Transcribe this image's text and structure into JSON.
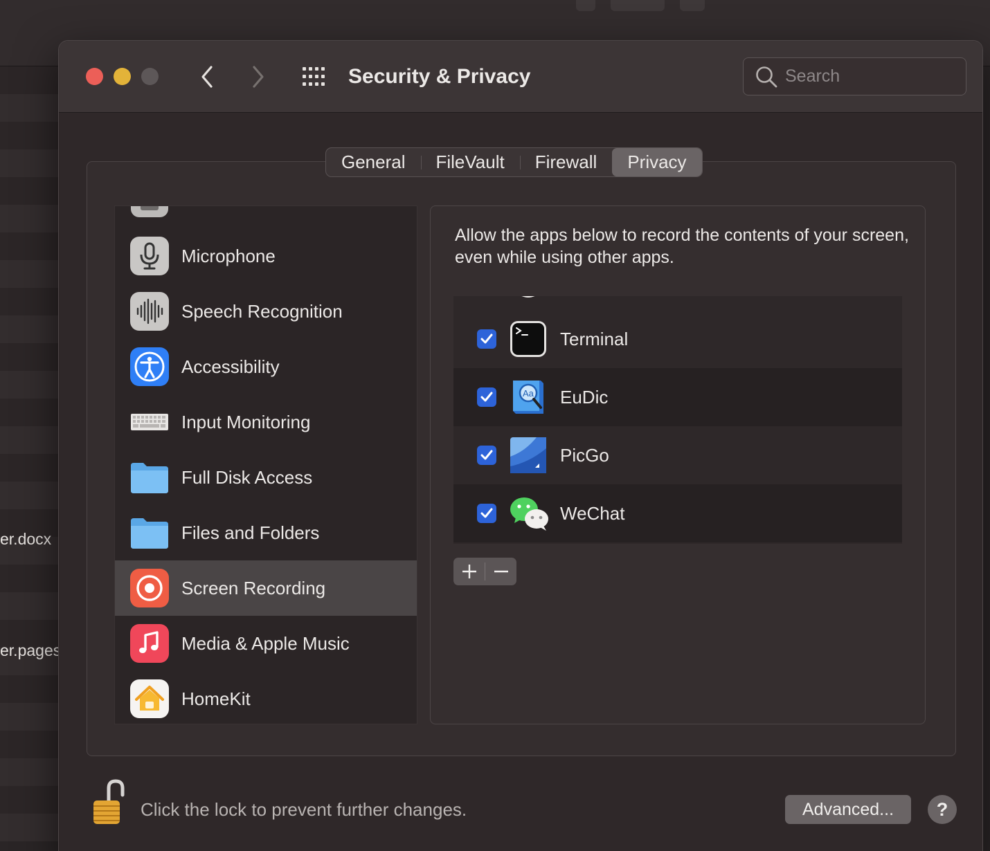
{
  "background": {
    "files": [
      "er.docx",
      "er.pages"
    ]
  },
  "window": {
    "title": "Security & Privacy",
    "search_placeholder": "Search"
  },
  "tabs": [
    {
      "label": "General",
      "active": false
    },
    {
      "label": "FileVault",
      "active": false
    },
    {
      "label": "Firewall",
      "active": false
    },
    {
      "label": "Privacy",
      "active": true
    }
  ],
  "categories": [
    {
      "label": "Microphone",
      "icon": "microphone-icon"
    },
    {
      "label": "Speech Recognition",
      "icon": "waveform-icon"
    },
    {
      "label": "Accessibility",
      "icon": "accessibility-icon"
    },
    {
      "label": "Input Monitoring",
      "icon": "keyboard-icon"
    },
    {
      "label": "Full Disk Access",
      "icon": "folder-icon"
    },
    {
      "label": "Files and Folders",
      "icon": "folder-icon"
    },
    {
      "label": "Screen Recording",
      "icon": "screen-recording-icon",
      "selected": true
    },
    {
      "label": "Media & Apple Music",
      "icon": "music-icon"
    },
    {
      "label": "HomeKit",
      "icon": "home-icon"
    }
  ],
  "detail": {
    "description": "Allow the apps below to record the contents of your screen, even while using other apps.",
    "apps": [
      {
        "name": "Terminal",
        "checked": true,
        "icon": "terminal-icon"
      },
      {
        "name": "EuDic",
        "checked": true,
        "icon": "eudic-icon"
      },
      {
        "name": "PicGo",
        "checked": true,
        "icon": "picgo-icon"
      },
      {
        "name": "WeChat",
        "checked": true,
        "icon": "wechat-icon"
      }
    ],
    "add_symbol": "+",
    "remove_symbol": "—"
  },
  "footer": {
    "lock_text": "Click the lock to prevent further changes.",
    "advanced_label": "Advanced...",
    "help_label": "?"
  },
  "colors": {
    "accent": "#2d63d9",
    "close": "#ec5f58",
    "minimize": "#e3b339",
    "selected_row": "#4a4546"
  }
}
